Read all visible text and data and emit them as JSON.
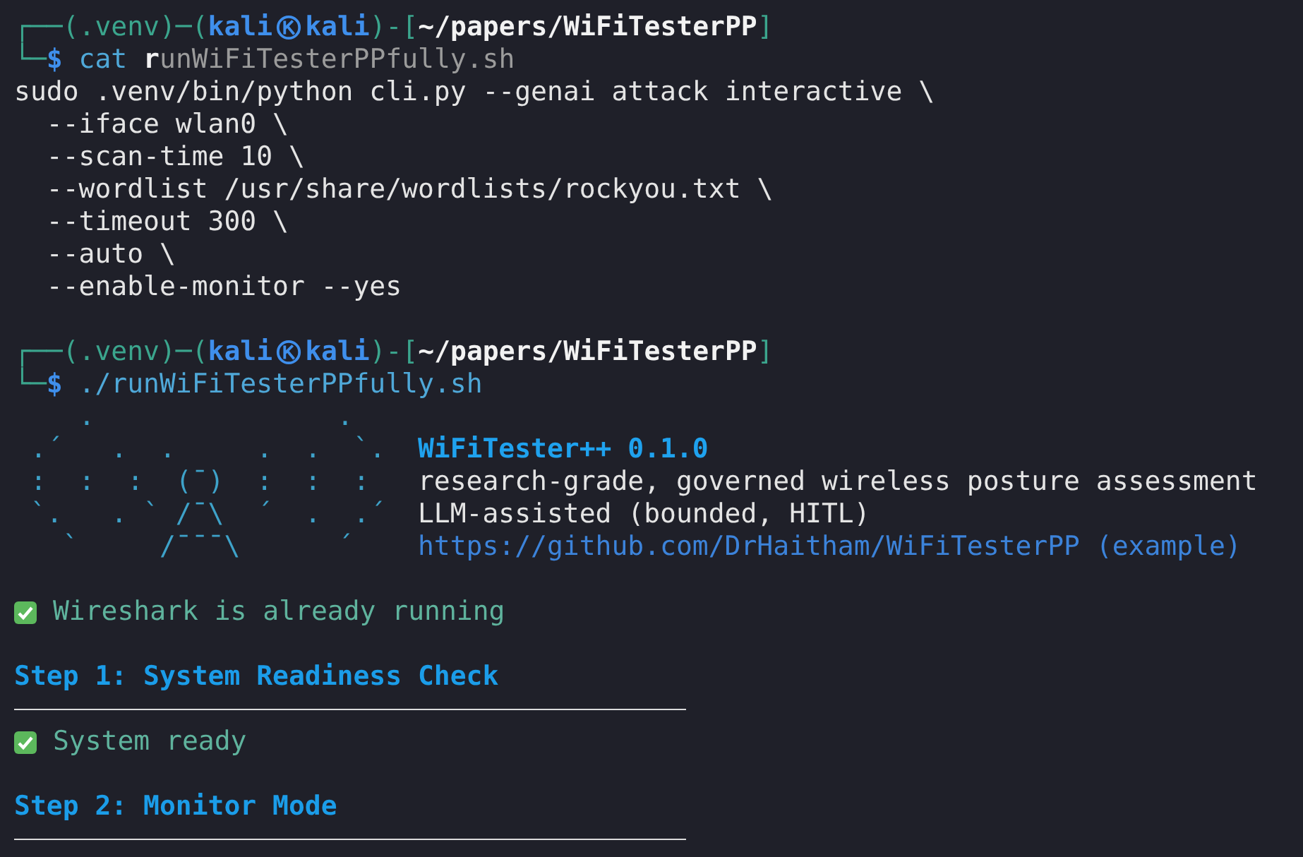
{
  "terminal": {
    "lines": [
      {
        "kind": "prompt_head",
        "lead": "┌──(",
        "venv": ".venv",
        "sep_env": ")─(",
        "user": "kali",
        "host": "kali",
        "sep_path": ")-[",
        "path": "~/papers/WiFiTesterPP",
        "close": "]"
      },
      {
        "kind": "prompt_input",
        "lead": "└─",
        "symbol": "$",
        "command": "cat",
        "argument_typed": "r",
        "argument_suggestion": "unWiFiTesterPPfully.sh"
      },
      {
        "kind": "output",
        "text": "sudo .venv/bin/python cli.py --genai attack interactive \\"
      },
      {
        "kind": "output",
        "text": "  --iface wlan0 \\"
      },
      {
        "kind": "output",
        "text": "  --scan-time 10 \\"
      },
      {
        "kind": "output",
        "text": "  --wordlist /usr/share/wordlists/rockyou.txt \\"
      },
      {
        "kind": "output",
        "text": "  --timeout 300 \\"
      },
      {
        "kind": "output",
        "text": "  --auto \\"
      },
      {
        "kind": "output",
        "text": "  --enable-monitor --yes"
      },
      {
        "kind": "blank"
      },
      {
        "kind": "prompt_head",
        "lead": "┌──(",
        "venv": ".venv",
        "sep_env": ")─(",
        "user": "kali",
        "host": "kali",
        "sep_path": ")-[",
        "path": "~/papers/WiFiTesterPP",
        "close": "]"
      },
      {
        "kind": "prompt_input",
        "lead": "└─",
        "symbol": "$",
        "command": "./runWiFiTesterPPfully.sh"
      },
      {
        "kind": "banner",
        "art": [
          "    .               .",
          " .´   .  .     .  .  `.",
          " :  :  :  (¯)  :  :  :",
          " `.   . ` /¯\\  ´  .  .´",
          "   `     /¯¯¯\\      ´"
        ],
        "info": [
          {
            "kind": "title",
            "text": "WiFiTester++ 0.1.0"
          },
          {
            "kind": "text",
            "text": "research-grade, governed wireless posture assessment"
          },
          {
            "kind": "text",
            "text": "LLM-assisted (bounded, HITL)"
          },
          {
            "kind": "link",
            "text": "https://github.com/DrHaitham/WiFiTesterPP (example)"
          }
        ]
      },
      {
        "kind": "blank"
      },
      {
        "kind": "success",
        "text": "Wireshark is already running"
      },
      {
        "kind": "blank"
      },
      {
        "kind": "heading",
        "text": "Step 1: System Readiness Check"
      },
      {
        "kind": "rule"
      },
      {
        "kind": "success",
        "text": "System ready"
      },
      {
        "kind": "blank"
      },
      {
        "kind": "heading",
        "text": "Step 2: Monitor Mode"
      },
      {
        "kind": "rule"
      }
    ]
  }
}
